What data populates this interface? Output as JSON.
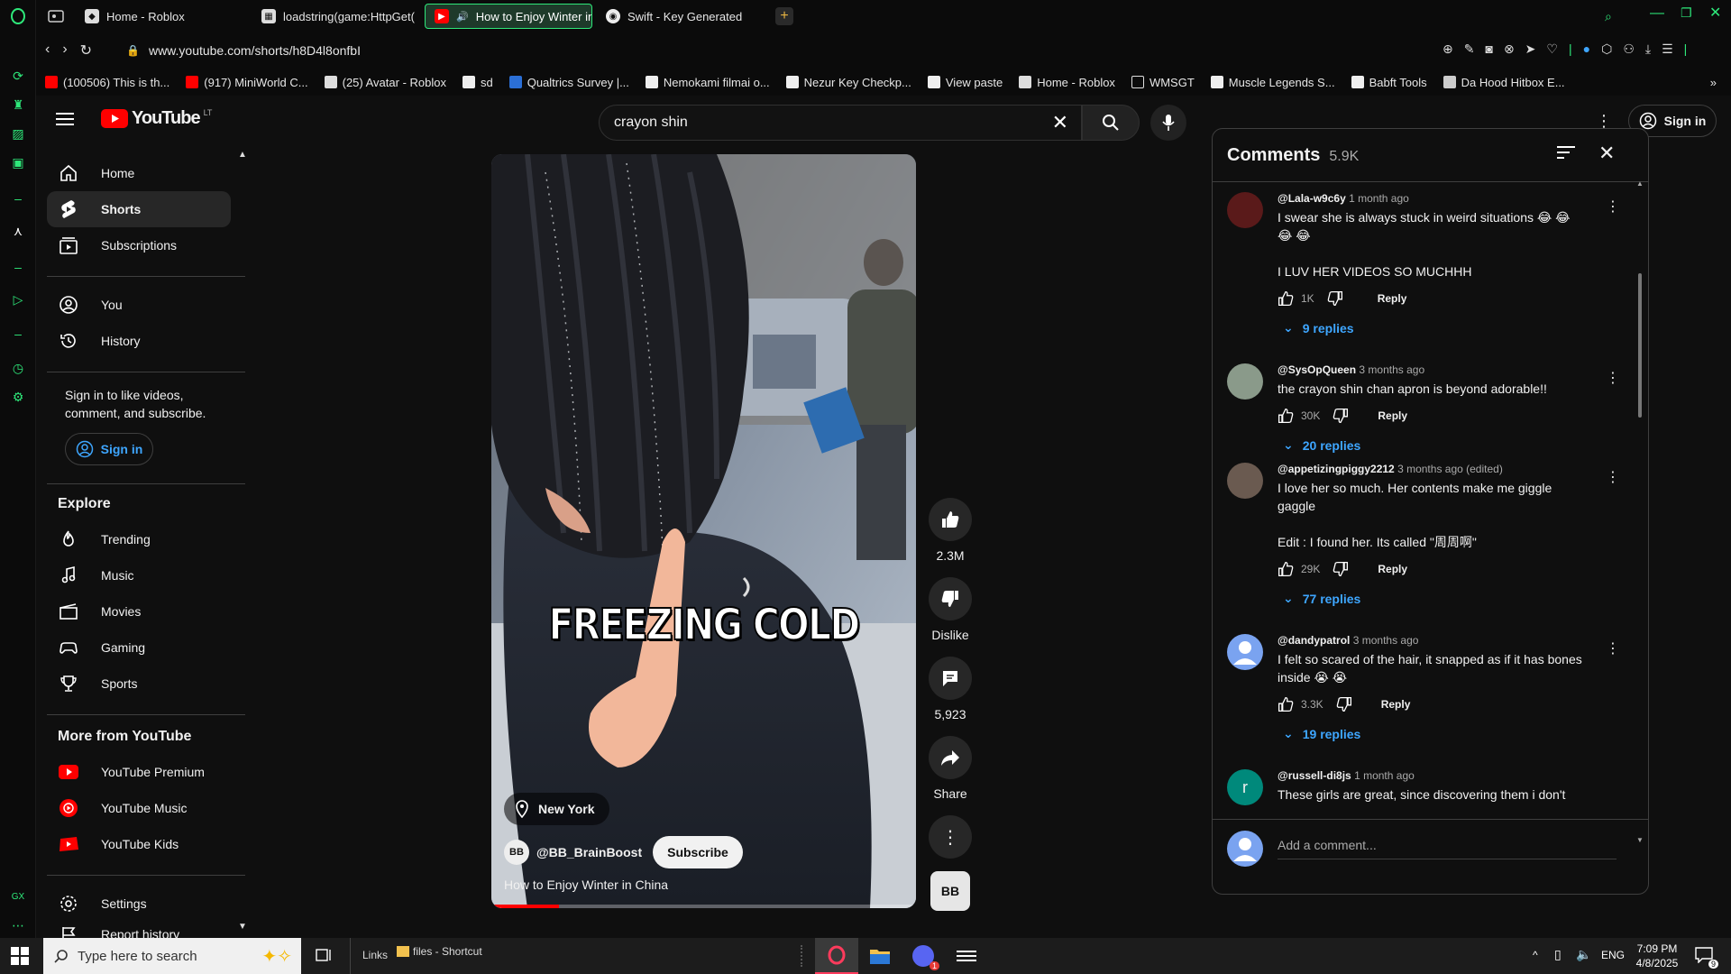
{
  "browser": {
    "tabs": [
      {
        "label": "Home - Roblox",
        "icon": "roblox-icon"
      },
      {
        "label": "loadstring(game:HttpGet(",
        "icon": "page-icon"
      },
      {
        "label": "How to Enjoy Winter in",
        "icon": "youtube-icon"
      },
      {
        "label": "Swift - Key Generated",
        "icon": "globe-icon"
      }
    ],
    "url": "www.youtube.com/shorts/h8D4l8onfbI",
    "bookmarks": [
      "(100506) This is th...",
      "(917) MiniWorld C...",
      "(25) Avatar - Roblox",
      "sd",
      "Qualtrics Survey |...",
      "Nemokami filmai o...",
      "Nezur Key Checkp...",
      "View paste",
      "Home - Roblox",
      "WMSGT",
      "Muscle Legends S...",
      "Babft Tools",
      "Da Hood Hitbox E..."
    ]
  },
  "youtube": {
    "logo_text": "YouTube",
    "region": "LT",
    "search_value": "crayon shin",
    "sign_in": "Sign in",
    "sidebar": {
      "main": [
        {
          "label": "Home",
          "icon": "home-icon"
        },
        {
          "label": "Shorts",
          "icon": "shorts-icon"
        },
        {
          "label": "Subscriptions",
          "icon": "subscriptions-icon"
        }
      ],
      "you": [
        {
          "label": "You",
          "icon": "account-icon"
        },
        {
          "label": "History",
          "icon": "history-icon"
        }
      ],
      "signin_prompt": "Sign in to like videos, comment, and subscribe.",
      "signin_button": "Sign in",
      "explore_title": "Explore",
      "explore": [
        {
          "label": "Trending",
          "icon": "trending-icon"
        },
        {
          "label": "Music",
          "icon": "music-icon"
        },
        {
          "label": "Movies",
          "icon": "movies-icon"
        },
        {
          "label": "Gaming",
          "icon": "gaming-icon"
        },
        {
          "label": "Sports",
          "icon": "sports-icon"
        }
      ],
      "more_title": "More from YouTube",
      "more": [
        {
          "label": "YouTube Premium"
        },
        {
          "label": "YouTube Music"
        },
        {
          "label": "YouTube Kids"
        }
      ],
      "settings": "Settings",
      "report_history": "Report history"
    },
    "short": {
      "caption": "FREEZING COLD",
      "location": "New York",
      "channel": "@BB_BrainBoost",
      "subscribe": "Subscribe",
      "title": "How to Enjoy Winter in China",
      "progress": 0.16,
      "likes": "2.3M",
      "dislike": "Dislike",
      "comments_count": "5,923",
      "share": "Share"
    },
    "comments": {
      "title": "Comments",
      "count": "5.9K",
      "add_placeholder": "Add a comment...",
      "items": [
        {
          "author": "@Lala-w9c6y",
          "time": "1 month ago",
          "text": "I swear she is always stuck in weird situations 😂 😂\n😂 😂\n\nI LUV HER VIDEOS SO MUCHHH",
          "likes": "1K",
          "reply": "Reply",
          "replies": "9 replies",
          "avatar_color": "#5a1a1a"
        },
        {
          "author": "@SysOpQueen",
          "time": "3 months ago",
          "text": "the crayon shin chan apron is beyond adorable!!",
          "likes": "30K",
          "reply": "Reply",
          "replies": "20 replies",
          "avatar_color": "#8a9a8a"
        },
        {
          "author": "@appetizingpiggy2212",
          "time": "3 months ago (edited)",
          "text": "I love her so much. Her contents make me giggle gaggle\n\nEdit : I found her. Its called \"周周啊\"",
          "likes": "29K",
          "reply": "Reply",
          "replies": "77 replies",
          "avatar_color": "#6a5a50"
        },
        {
          "author": "@dandypatrol",
          "time": "3 months ago",
          "text": "I felt so scared of the hair, it snapped as if it has bones inside 😭 😭",
          "likes": "3.3K",
          "reply": "Reply",
          "replies": "19 replies",
          "avatar_color": "#7aa3f0"
        },
        {
          "author": "@russell-di8js",
          "time": "1 month ago",
          "text": "These girls are great,  since discovering them i don't",
          "avatar_letter": "r",
          "avatar_color": "#00897b"
        }
      ]
    }
  },
  "taskbar": {
    "search_placeholder": "Type here to search",
    "links": "Links",
    "shortcut": "files - Shortcut",
    "lang": "ENG",
    "time": "7:09 PM",
    "date": "4/8/2025",
    "notif_count": "9"
  }
}
